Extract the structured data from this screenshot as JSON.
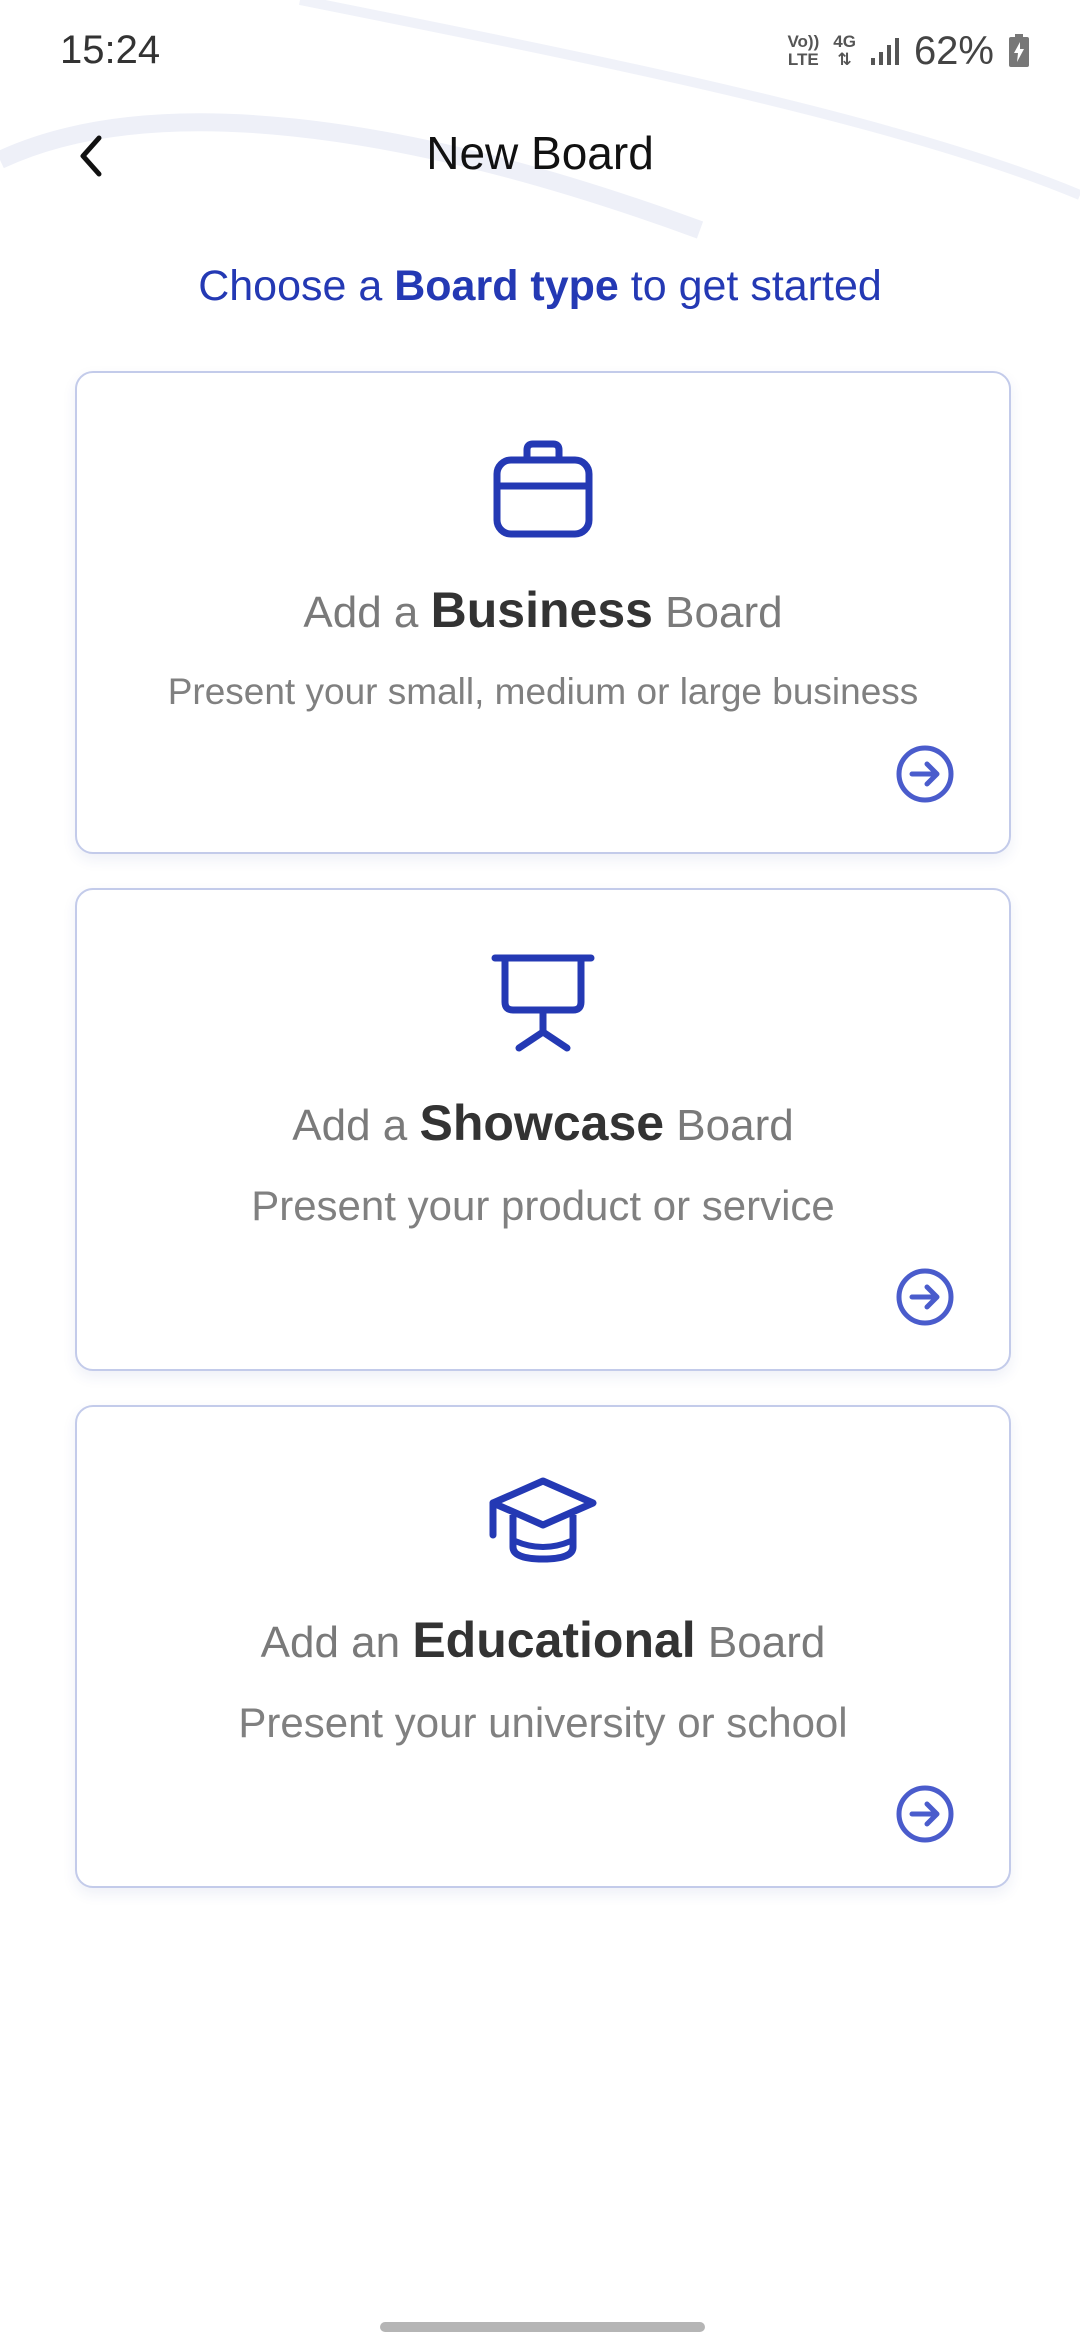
{
  "status_bar": {
    "time": "15:24",
    "volte_line1": "Vo))",
    "volte_line2": "LTE",
    "network": "4G",
    "battery": "62%"
  },
  "header": {
    "title": "New Board",
    "back_icon": "chevron-left-icon"
  },
  "subtitle": {
    "prefix": "Choose a ",
    "bold": "Board type",
    "suffix": " to get started"
  },
  "cards": [
    {
      "icon": "briefcase-icon",
      "title_prefix": "Add a ",
      "title_bold": "Business",
      "title_suffix": " Board",
      "description": "Present your small, medium or large business",
      "arrow_icon": "arrow-right-circle-icon"
    },
    {
      "icon": "presentation-board-icon",
      "title_prefix": "Add a ",
      "title_bold": "Showcase",
      "title_suffix": " Board",
      "description": "Present your product or service",
      "arrow_icon": "arrow-right-circle-icon"
    },
    {
      "icon": "graduation-cap-icon",
      "title_prefix": "Add an ",
      "title_bold": "Educational",
      "title_suffix": " Board",
      "description": "Present your university or school",
      "arrow_icon": "arrow-right-circle-icon"
    }
  ],
  "colors": {
    "accent": "#2439b4",
    "card_border": "#c3cbea",
    "arrow": "#4a5ccc"
  }
}
